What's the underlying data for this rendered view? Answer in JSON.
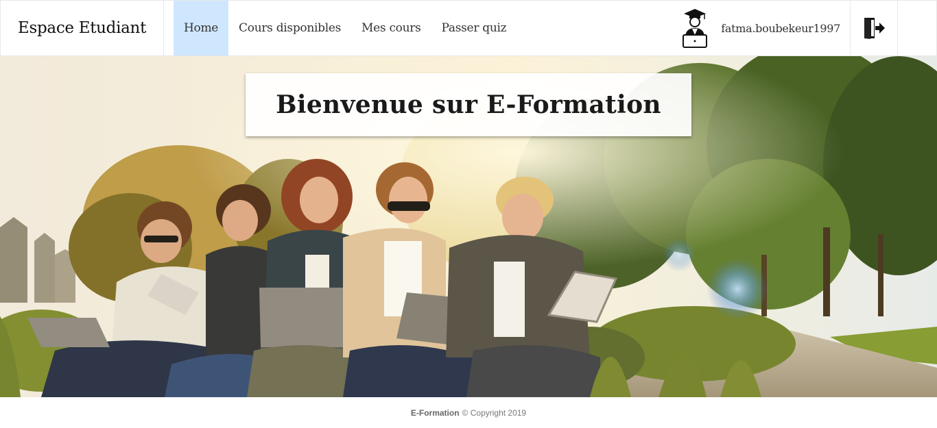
{
  "navbar": {
    "brand": "Espace Etudiant",
    "links": [
      {
        "label": "Home",
        "active": true
      },
      {
        "label": "Cours disponibles",
        "active": false
      },
      {
        "label": "Mes cours",
        "active": false
      },
      {
        "label": "Passer quiz",
        "active": false
      }
    ],
    "user": {
      "name": "fatma.boubekeur1997",
      "avatar_icon": "graduate-student-laptop-icon"
    },
    "logout_icon": "logout-door-icon"
  },
  "hero": {
    "title": "Bienvenue sur E-Formation",
    "image": "students-with-laptops-in-park-photo"
  },
  "footer": {
    "brand": "E-Formation",
    "copyright": "© Copyright 2019"
  },
  "colors": {
    "active_nav": "#cfe6ff",
    "text_dark": "#1a1a1a"
  }
}
